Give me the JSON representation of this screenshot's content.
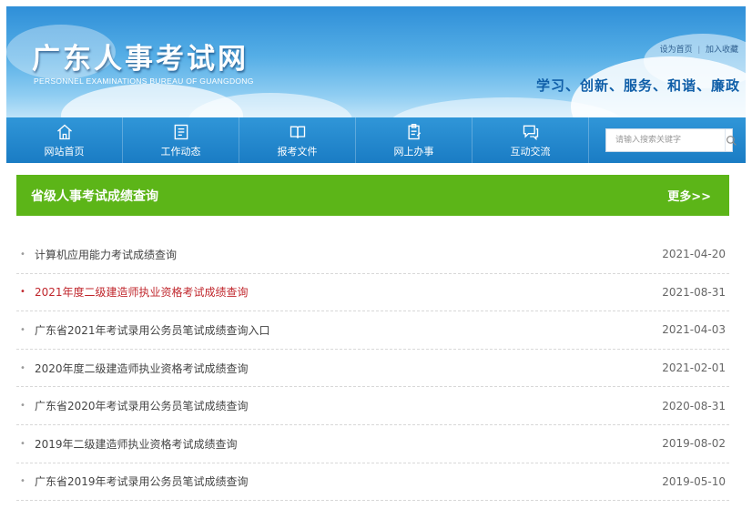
{
  "header": {
    "title": "广东人事考试网",
    "subtitle": "PERSONNEL EXAMINATIONS BUREAU OF GUANGDONG",
    "set_home": "设为首页",
    "separator": "|",
    "favorite": "加入收藏",
    "slogan": "学习、创新、服务、和谐、廉政"
  },
  "nav": {
    "items": [
      {
        "label": "网站首页",
        "icon": "home-icon"
      },
      {
        "label": "工作动态",
        "icon": "news-icon"
      },
      {
        "label": "报考文件",
        "icon": "book-icon"
      },
      {
        "label": "网上办事",
        "icon": "clipboard-icon"
      },
      {
        "label": "互动交流",
        "icon": "chat-icon"
      }
    ],
    "search_placeholder": "请输入搜索关键字"
  },
  "section": {
    "title": "省级人事考试成绩查询",
    "more": "更多>>"
  },
  "list": [
    {
      "title": "计算机应用能力考试成绩查询",
      "date": "2021-04-20",
      "highlight": false
    },
    {
      "title": "2021年度二级建造师执业资格考试成绩查询",
      "date": "2021-08-31",
      "highlight": true
    },
    {
      "title": "广东省2021年考试录用公务员笔试成绩查询入口",
      "date": "2021-04-03",
      "highlight": false
    },
    {
      "title": "2020年度二级建造师执业资格考试成绩查询",
      "date": "2021-02-01",
      "highlight": false
    },
    {
      "title": "广东省2020年考试录用公务员笔试成绩查询",
      "date": "2020-08-31",
      "highlight": false
    },
    {
      "title": "2019年二级建造师执业资格考试成绩查询",
      "date": "2019-08-02",
      "highlight": false
    },
    {
      "title": "广东省2019年考试录用公务员笔试成绩查询",
      "date": "2019-05-10",
      "highlight": false
    }
  ],
  "colors": {
    "nav_blue": "#1a7cc4",
    "header_green": "#5cb518",
    "highlight_red": "#c0272d",
    "slogan_blue": "#0f5ea8"
  }
}
